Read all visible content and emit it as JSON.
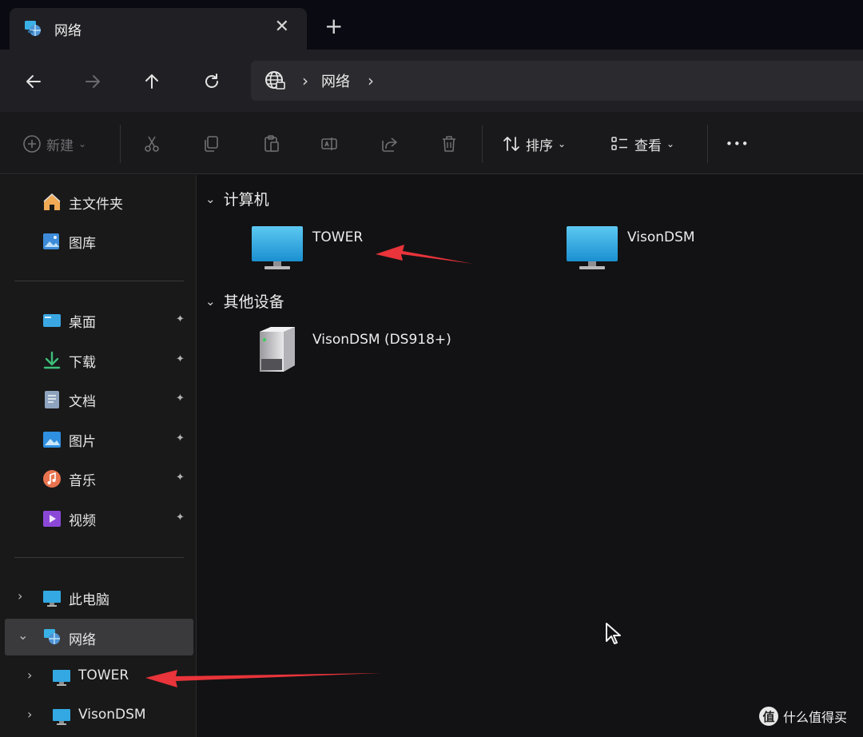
{
  "tab": {
    "title": "网络",
    "close": "✕",
    "new_tab": "+"
  },
  "address": {
    "crumb": "网络",
    "sep1": "›",
    "sep2": "›"
  },
  "toolbar": {
    "new_label": "新建",
    "sort_label": "排序",
    "view_label": "查看",
    "more": "•••",
    "caret": "⌄"
  },
  "sidebar": {
    "home": "主文件夹",
    "gallery": "图库",
    "pinned": [
      {
        "label": "桌面"
      },
      {
        "label": "下载"
      },
      {
        "label": "文档"
      },
      {
        "label": "图片"
      },
      {
        "label": "音乐"
      },
      {
        "label": "视频"
      }
    ],
    "pin_glyph": "📌",
    "this_pc": "此电脑",
    "network": "网络",
    "network_children": [
      "TOWER",
      "VisonDSM"
    ],
    "expand_closed": "›",
    "expand_open": "⌄"
  },
  "content": {
    "groups": [
      {
        "title": "计算机",
        "items": [
          "TOWER",
          "VisonDSM"
        ]
      },
      {
        "title": "其他设备",
        "items": [
          "VisonDSM (DS918+)"
        ]
      }
    ],
    "group_chevron": "⌄"
  },
  "watermark": {
    "logo": "值",
    "text": "什么值得买"
  },
  "colors": {
    "accent_monitor": "#2aa6df",
    "arrow": "#e8343a",
    "selected": "#3a3a3d"
  }
}
